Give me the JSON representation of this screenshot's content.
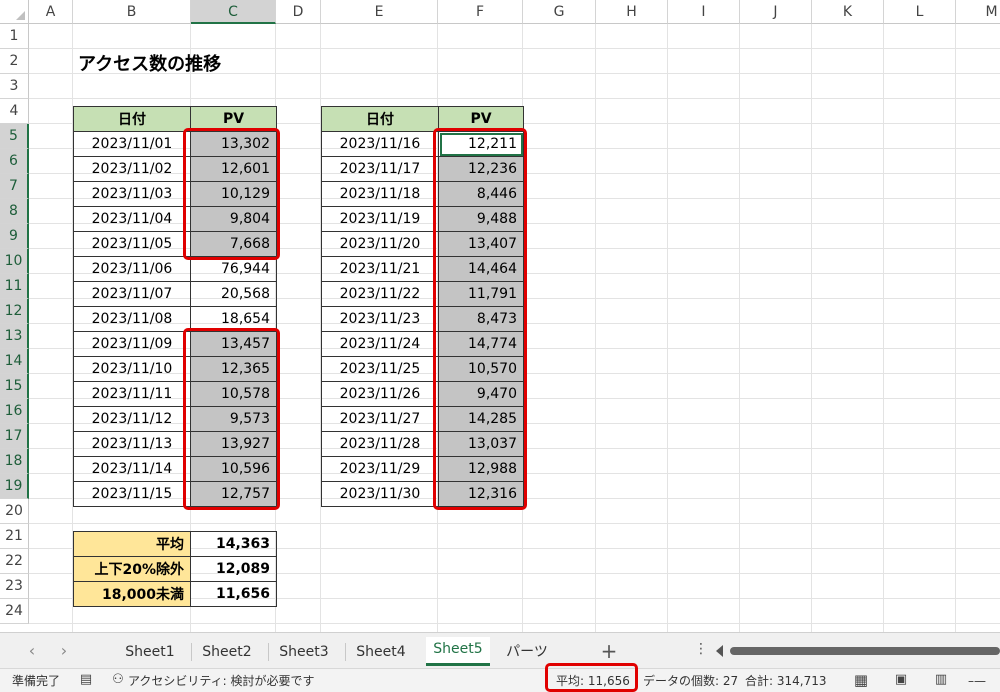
{
  "columns": [
    "A",
    "B",
    "C",
    "D",
    "E",
    "F",
    "G",
    "H",
    "I",
    "J",
    "K",
    "L",
    "M"
  ],
  "rows": [
    "1",
    "2",
    "3",
    "4",
    "5",
    "6",
    "7",
    "8",
    "9",
    "10",
    "11",
    "12",
    "13",
    "14",
    "15",
    "16",
    "17",
    "18",
    "19",
    "20",
    "21",
    "22",
    "23",
    "24"
  ],
  "sheet_title": "アクセス数の推移",
  "table1": {
    "header_date": "日付",
    "header_pv": "PV",
    "rows": [
      [
        "2023/11/01",
        "13,302"
      ],
      [
        "2023/11/02",
        "12,601"
      ],
      [
        "2023/11/03",
        "10,129"
      ],
      [
        "2023/11/04",
        "9,804"
      ],
      [
        "2023/11/05",
        "7,668"
      ],
      [
        "2023/11/06",
        "76,944"
      ],
      [
        "2023/11/07",
        "20,568"
      ],
      [
        "2023/11/08",
        "18,654"
      ],
      [
        "2023/11/09",
        "13,457"
      ],
      [
        "2023/11/10",
        "12,365"
      ],
      [
        "2023/11/11",
        "10,578"
      ],
      [
        "2023/11/12",
        "9,573"
      ],
      [
        "2023/11/13",
        "13,927"
      ],
      [
        "2023/11/14",
        "10,596"
      ],
      [
        "2023/11/15",
        "12,757"
      ]
    ]
  },
  "table2": {
    "header_date": "日付",
    "header_pv": "PV",
    "rows": [
      [
        "2023/11/16",
        "12,211"
      ],
      [
        "2023/11/17",
        "12,236"
      ],
      [
        "2023/11/18",
        "8,446"
      ],
      [
        "2023/11/19",
        "9,488"
      ],
      [
        "2023/11/20",
        "13,407"
      ],
      [
        "2023/11/21",
        "14,464"
      ],
      [
        "2023/11/22",
        "11,791"
      ],
      [
        "2023/11/23",
        "8,473"
      ],
      [
        "2023/11/24",
        "14,774"
      ],
      [
        "2023/11/25",
        "10,570"
      ],
      [
        "2023/11/26",
        "9,470"
      ],
      [
        "2023/11/27",
        "14,285"
      ],
      [
        "2023/11/28",
        "13,037"
      ],
      [
        "2023/11/29",
        "12,988"
      ],
      [
        "2023/11/30",
        "12,316"
      ]
    ]
  },
  "summary": [
    {
      "label": "平均",
      "value": "14,363"
    },
    {
      "label": "上下20%除外",
      "value": "12,089"
    },
    {
      "label": "18,000未満",
      "value": "11,656"
    }
  ],
  "tabs": [
    "Sheet1",
    "Sheet2",
    "Sheet3",
    "Sheet4",
    "Sheet5",
    "パーツ"
  ],
  "active_tab": "Sheet5",
  "add_sheet_label": "+",
  "status": {
    "ready": "準備完了",
    "accessibility": "アクセシビリティ: 検討が必要です",
    "average": "平均: 11,656",
    "count": "データの個数: 27",
    "sum": "合計: 314,713"
  },
  "colors": {
    "accent": "#217346",
    "header_fill": "#c6e0b4",
    "summary_fill": "#ffe699",
    "highlight": "#e00000",
    "selection": "#c4c4c4"
  }
}
